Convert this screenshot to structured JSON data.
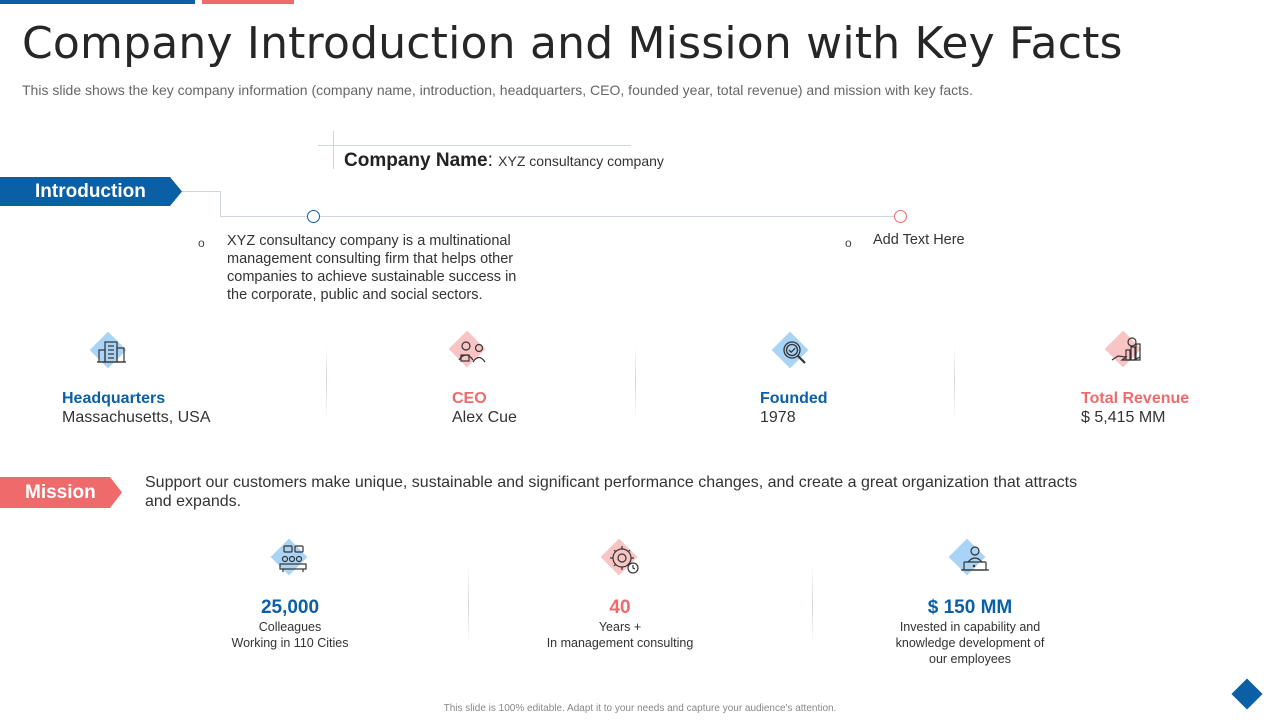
{
  "header": {
    "title": "Company Introduction and Mission with Key Facts",
    "subtitle": "This slide shows the key company information (company name, introduction, headquarters, CEO, founded year, total revenue) and mission with key facts."
  },
  "introduction": {
    "badge_label": "Introduction",
    "company_name_label": "Company Name",
    "company_name_separator": ": ",
    "company_name_value": "XYZ consultancy company",
    "bullet_symbol": "o",
    "left_text": "XYZ consultancy company is a multinational management consulting firm that helps other companies to achieve sustainable success in the corporate, public and social sectors.",
    "right_text": "Add Text Here"
  },
  "facts": [
    {
      "icon": "building-icon",
      "label": "Headquarters",
      "value": "Massachusetts, USA",
      "color": "#0b5fa5"
    },
    {
      "icon": "ceo-icon",
      "label": "CEO",
      "value": "Alex Cue",
      "color": "#ef6b6b"
    },
    {
      "icon": "magnifier-check-icon",
      "label": "Founded",
      "value": "1978",
      "color": "#0b5fa5"
    },
    {
      "icon": "money-hand-icon",
      "label": "Total Revenue",
      "value": "$ 5,415 MM",
      "color": "#ef6b6b"
    }
  ],
  "mission": {
    "badge_label": "Mission",
    "text": "Support our customers make unique, sustainable and significant performance changes, and create a great organization that attracts and expands."
  },
  "stats": [
    {
      "icon": "team-meeting-icon",
      "number": "25,000",
      "line1": "Colleagues",
      "line2": "Working in 110 Cities",
      "line3": "",
      "color": "#0b5fa5"
    },
    {
      "icon": "gear-clock-icon",
      "number": "40",
      "line1": "Years +",
      "line2": "In management consulting",
      "line3": "",
      "color": "#ef6b6b"
    },
    {
      "icon": "laptop-user-icon",
      "number": "$ 150 MM",
      "line1": "Invested  in capability and",
      "line2": "knowledge development  of",
      "line3": "our employees",
      "color": "#0b5fa5"
    }
  ],
  "footer": {
    "text": "This slide is 100% editable. Adapt it to your needs and capture your audience's attention."
  },
  "colors": {
    "primary": "#0b5fa5",
    "accent": "#ef6b6b"
  }
}
